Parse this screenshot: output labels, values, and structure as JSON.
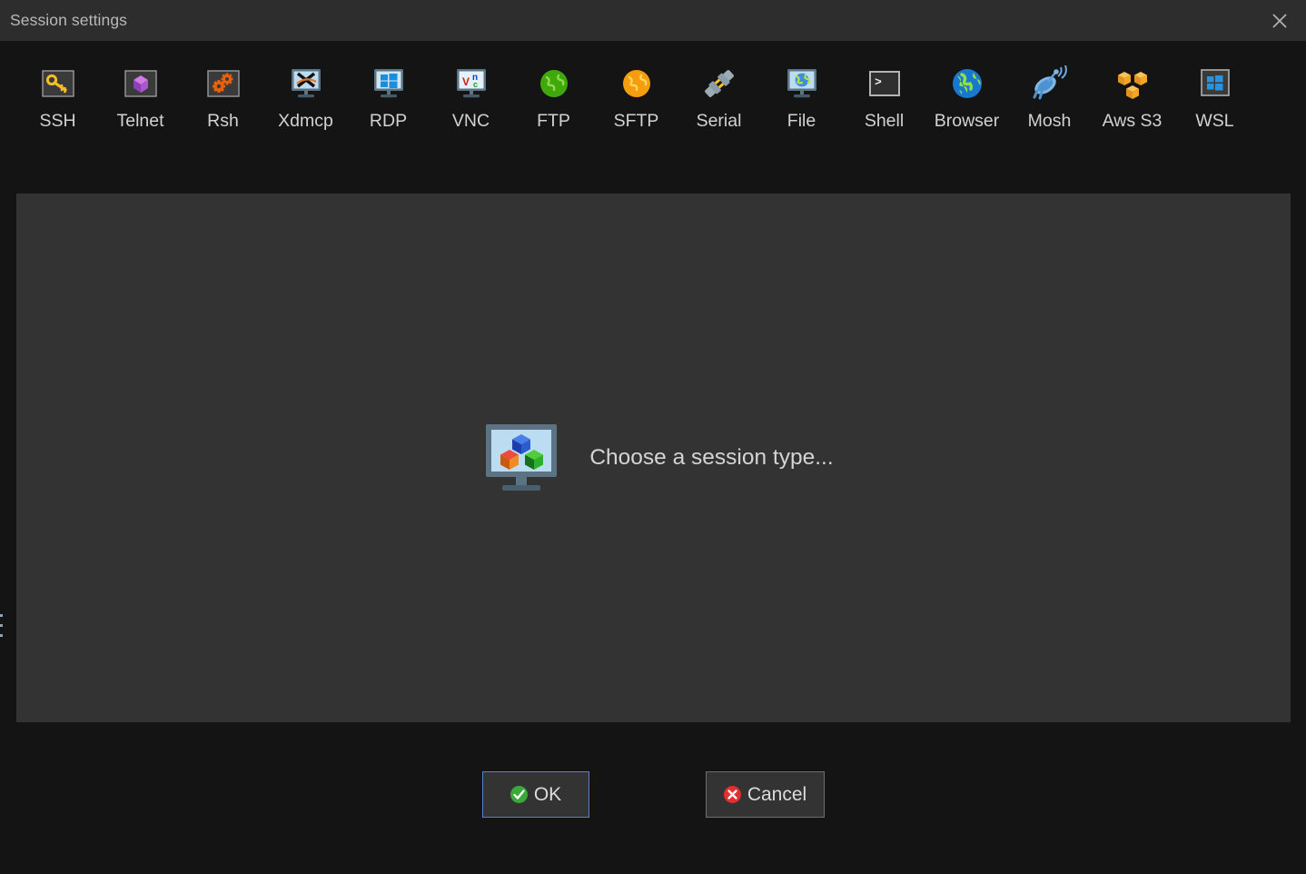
{
  "window": {
    "title": "Session settings",
    "close_icon": "close-icon",
    "background_color": "#141414",
    "titlebar_color": "#2d2d2d",
    "panel_color": "#333333"
  },
  "toolbar": {
    "items": [
      {
        "label": "SSH",
        "icon": "key-icon"
      },
      {
        "label": "Telnet",
        "icon": "purple-cube-icon"
      },
      {
        "label": "Rsh",
        "icon": "gears-icon"
      },
      {
        "label": "Xdmcp",
        "icon": "x-monitor-icon"
      },
      {
        "label": "RDP",
        "icon": "windows-monitor-icon"
      },
      {
        "label": "VNC",
        "icon": "vnc-monitor-icon"
      },
      {
        "label": "FTP",
        "icon": "green-globe-icon"
      },
      {
        "label": "SFTP",
        "icon": "orange-globe-icon"
      },
      {
        "label": "Serial",
        "icon": "serial-plug-icon"
      },
      {
        "label": "File",
        "icon": "globe-monitor-icon"
      },
      {
        "label": "Shell",
        "icon": "terminal-icon"
      },
      {
        "label": "Browser",
        "icon": "blue-globe-icon"
      },
      {
        "label": "Mosh",
        "icon": "satellite-dish-icon"
      },
      {
        "label": "Aws S3",
        "icon": "aws-cubes-icon"
      },
      {
        "label": "WSL",
        "icon": "windows-logo-icon"
      }
    ]
  },
  "main": {
    "placeholder_text": "Choose a session type...",
    "placeholder_icon": "monitor-cubes-icon"
  },
  "footer": {
    "ok_label": "OK",
    "ok_icon": "green-check-icon",
    "ok_focus_color": "#5a7fd0",
    "cancel_label": "Cancel",
    "cancel_icon": "red-x-icon",
    "cancel_border_color": "#6e6e6e"
  }
}
